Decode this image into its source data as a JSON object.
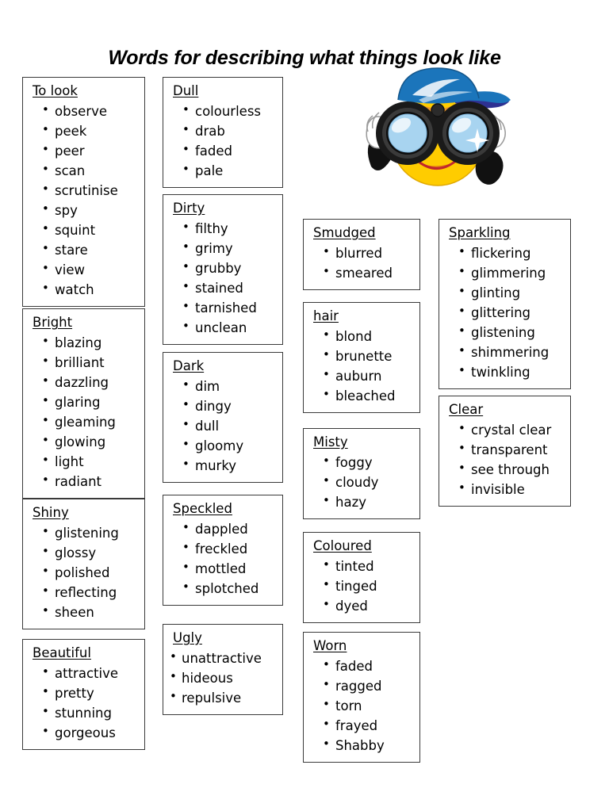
{
  "page": {
    "title": "Words for describing what things look like",
    "illustration": "smiley-with-binoculars-clipart"
  },
  "colors": {
    "cap_blue": "#1b75bb",
    "cap_brim_dark": "#2e3192",
    "face_yellow": "#ffcc00",
    "lens_blue": "#a8d4f0",
    "binocular_black": "#1a1a1a",
    "glove_white": "#ffffff",
    "mouth_red": "#c1272d",
    "box_border": "#3a3a3a",
    "text": "#000000",
    "background": "#ffffff"
  },
  "columns": [
    {
      "id": "column-1",
      "boxes": [
        {
          "id": "to-look",
          "heading": "To look",
          "words": [
            "observe",
            "peek",
            "peer",
            "scan",
            "scrutinise",
            "spy",
            "squint",
            "stare",
            "view",
            "watch"
          ]
        },
        {
          "id": "bright",
          "heading": "Bright",
          "words": [
            "blazing",
            "brilliant",
            "dazzling",
            "glaring",
            "gleaming",
            "glowing",
            "light",
            "radiant"
          ]
        },
        {
          "id": "shiny",
          "heading": "Shiny",
          "words": [
            "glistening",
            "glossy",
            "polished",
            "reflecting",
            "sheen"
          ]
        },
        {
          "id": "beautiful",
          "heading": "Beautiful",
          "words": [
            "attractive",
            "pretty",
            "stunning",
            "gorgeous"
          ]
        }
      ]
    },
    {
      "id": "column-2",
      "boxes": [
        {
          "id": "dull",
          "heading": "Dull",
          "words": [
            "colourless",
            "drab",
            "faded",
            "pale"
          ]
        },
        {
          "id": "dirty",
          "heading": "Dirty",
          "words": [
            "filthy",
            "grimy",
            "grubby",
            "stained",
            "tarnished",
            "unclean"
          ]
        },
        {
          "id": "dark",
          "heading": "Dark",
          "words": [
            "dim",
            "dingy",
            "dull",
            "gloomy",
            "murky"
          ]
        },
        {
          "id": "speckled",
          "heading": "Speckled",
          "words": [
            "dappled",
            "freckled",
            "mottled",
            "splotched"
          ]
        },
        {
          "id": "ugly",
          "heading": "Ugly",
          "words": [
            "unattractive",
            "hideous",
            "repulsive"
          ]
        }
      ]
    },
    {
      "id": "column-3",
      "boxes": [
        {
          "id": "smudged",
          "heading": "Smudged",
          "words": [
            "blurred",
            "smeared"
          ]
        },
        {
          "id": "hair",
          "heading": "hair",
          "words": [
            "blond",
            "brunette",
            "auburn",
            "bleached"
          ]
        },
        {
          "id": "misty",
          "heading": "Misty",
          "words": [
            "foggy",
            "cloudy",
            "hazy"
          ]
        },
        {
          "id": "coloured",
          "heading": "Coloured",
          "words": [
            "tinted",
            "tinged",
            "dyed"
          ]
        },
        {
          "id": "worn",
          "heading": "Worn",
          "words": [
            "faded",
            "ragged",
            "torn",
            "frayed",
            "Shabby"
          ]
        }
      ]
    },
    {
      "id": "column-4",
      "boxes": [
        {
          "id": "sparkling",
          "heading": "Sparkling",
          "words": [
            "flickering",
            "glimmering",
            "glinting",
            "glittering",
            "glistening",
            "shimmering",
            "twinkling"
          ]
        },
        {
          "id": "clear",
          "heading": "Clear",
          "words": [
            "crystal clear",
            "transparent",
            "see through",
            "invisible"
          ]
        }
      ]
    }
  ]
}
